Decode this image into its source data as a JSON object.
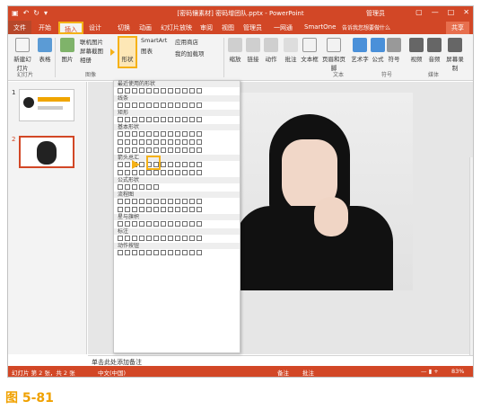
{
  "window": {
    "title": "[密码镶素材] 密码增团队.pptx - PowerPoint",
    "user": "管理员"
  },
  "tabs": [
    "开始",
    "插入",
    "设计",
    "切换",
    "动画",
    "幻灯片放映",
    "审阅",
    "视图",
    "管理员",
    "一网通",
    "SmartOne",
    "告诉我您想要做什么"
  ],
  "file_tab": "文件",
  "share_label": "共享",
  "ribbon": {
    "new_slide": "新建幻灯片",
    "table": "表格",
    "pictures": "图片",
    "online_pictures": "联机图片",
    "screenshot": "屏幕截图",
    "album": "相册",
    "shapes": "形状",
    "smartart": "SmartArt",
    "chart": "图表",
    "store": "应用商店",
    "addins": "我的加载项",
    "zoom": "缩放",
    "link": "链接",
    "action": "动作",
    "comment": "批注",
    "textbox": "文本框",
    "header_footer": "页眉和页脚",
    "wordart": "艺术字",
    "equation": "公式",
    "symbol": "符号",
    "video": "视频",
    "audio": "音频",
    "screen_record": "屏幕录制",
    "group_slide": "幻灯片",
    "group_images": "图像",
    "group_text": "文本",
    "group_symbols": "符号",
    "group_media": "媒体"
  },
  "shapes_menu": {
    "recent": "最近使用的形状",
    "lines": "线条",
    "rectangles": "矩形",
    "basic": "基本形状",
    "arrows": "箭头总汇",
    "equation": "公式形状",
    "flowchart": "流程图",
    "stars": "星与旗帜",
    "callouts": "标注",
    "actions": "动作按钮"
  },
  "slides": [
    {
      "number": "1"
    },
    {
      "number": "2"
    }
  ],
  "notes_placeholder": "单击此处添加备注",
  "status": {
    "slide_info": "幻灯片 第 2 张，共 2 张",
    "language": "中文(中国)",
    "notes": "备注",
    "comments": "批注",
    "zoom": "83%"
  },
  "caption": "图 5-81"
}
